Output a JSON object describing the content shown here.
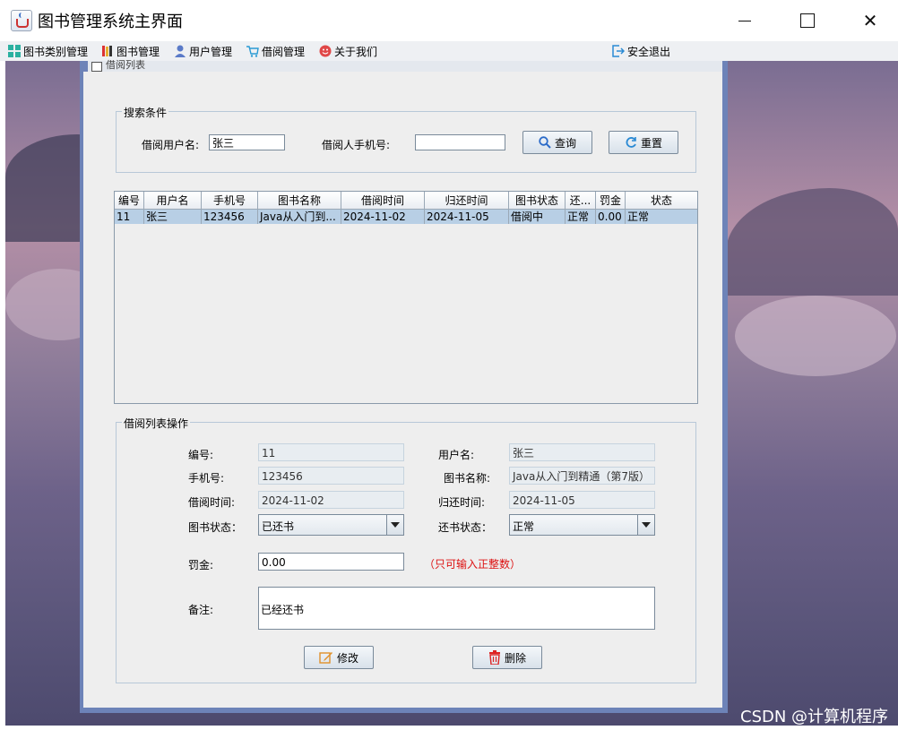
{
  "window": {
    "title": "图书管理系统主界面",
    "controls": {
      "minimize": "min",
      "maximize": "max",
      "close": "✕"
    }
  },
  "menubar": {
    "items": [
      {
        "label": "图书类别管理",
        "icon": "grid-icon"
      },
      {
        "label": "图书管理",
        "icon": "books-icon"
      },
      {
        "label": "用户管理",
        "icon": "user-icon"
      },
      {
        "label": "借阅管理",
        "icon": "cart-icon"
      },
      {
        "label": "关于我们",
        "icon": "smile-icon"
      }
    ],
    "exit": {
      "label": "安全退出",
      "icon": "exit-icon"
    }
  },
  "internal_frame": {
    "title": "借阅列表"
  },
  "search": {
    "group_title": "搜索条件",
    "username_label": "借阅用户名:",
    "username_value": "张三",
    "phone_label": "借阅人手机号:",
    "phone_value": "",
    "query_button": "查询",
    "reset_button": "重置"
  },
  "table": {
    "columns": [
      "编号",
      "用户名",
      "手机号",
      "图书名称",
      "借阅时间",
      "归还时间",
      "图书状态",
      "还...",
      "罚金",
      "状态"
    ],
    "rows": [
      [
        "11",
        "张三",
        "123456",
        "Java从入门到...",
        "2024-11-02",
        "2024-11-05",
        "借阅中",
        "正常",
        "0.00",
        "正常"
      ]
    ]
  },
  "ops": {
    "group_title": "借阅列表操作",
    "id_label": "编号:",
    "id_value": "11",
    "username_label": "用户名:",
    "username_value": "张三",
    "phone_label": "手机号:",
    "phone_value": "123456",
    "book_label": "图书名称:",
    "book_value": "Java从入门到精通（第7版）",
    "borrow_label": "借阅时间:",
    "borrow_value": "2024-11-02",
    "return_label": "归还时间:",
    "return_value": "2024-11-05",
    "book_status_label": "图书状态：",
    "book_status_value": "已还书",
    "return_status_label": "还书状态：",
    "return_status_value": "正常",
    "fine_label": "罚金:",
    "fine_value": "0.00",
    "fine_note": "（只可输入正整数）",
    "remark_label": "备注:",
    "remark_value": "已经还书",
    "edit_button": "修改",
    "delete_button": "删除"
  },
  "watermark": "CSDN @计算机程序"
}
